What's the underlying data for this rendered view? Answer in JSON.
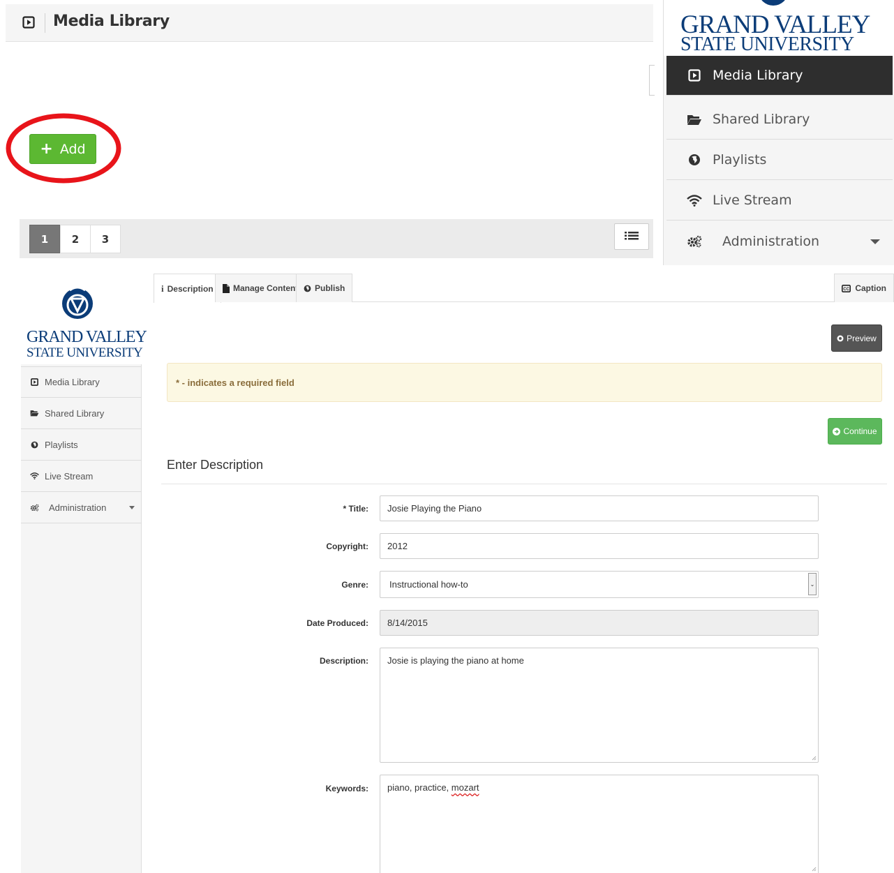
{
  "top_panel": {
    "header_title": "Media Library",
    "add_label": "Add",
    "pages": [
      "1",
      "2",
      "3"
    ],
    "active_page": "1"
  },
  "top_nav": {
    "logo_line1": "GRAND VALLEY",
    "logo_line2": "STATE UNIVERSITY",
    "items": [
      {
        "label": "Media Library",
        "icon": "play-square-icon",
        "active": true
      },
      {
        "label": "Shared Library",
        "icon": "folder-open-icon"
      },
      {
        "label": "Playlists",
        "icon": "globe-icon"
      },
      {
        "label": "Live Stream",
        "icon": "wifi-icon"
      },
      {
        "label": "Administration",
        "icon": "cogs-icon",
        "has_dropdown": true
      }
    ]
  },
  "side_nav": {
    "logo_line1": "GRAND VALLEY",
    "logo_line2": "STATE UNIVERSITY",
    "items": [
      {
        "label": "Media Library",
        "icon": "play-square-icon"
      },
      {
        "label": "Shared Library",
        "icon": "folder-open-icon"
      },
      {
        "label": "Playlists",
        "icon": "globe-icon"
      },
      {
        "label": "Live Stream",
        "icon": "wifi-icon"
      },
      {
        "label": "Administration",
        "icon": "cogs-icon",
        "has_dropdown": true
      }
    ]
  },
  "tabs": {
    "description": "Description",
    "manage_content": "Manage Content",
    "publish": "Publish",
    "caption": "Caption"
  },
  "actions": {
    "preview": "Preview",
    "continue": "Continue"
  },
  "alert": "* - indicates a required field",
  "section_title": "Enter Description",
  "form": {
    "title_label": "* Title:",
    "title_value": "Josie Playing the Piano",
    "copyright_label": "Copyright:",
    "copyright_value": "2012",
    "genre_label": "Genre:",
    "genre_value": "Instructional how-to",
    "date_label": "Date Produced:",
    "date_value": "8/14/2015",
    "description_label": "Description:",
    "description_value": "Josie is playing the piano at home",
    "keywords_label": "Keywords:",
    "keywords_value_plain": "piano, practice, ",
    "keywords_value_misspelled": "mozart"
  },
  "colors": {
    "gvsu_blue": "#0b3c78",
    "add_green": "#5cb832",
    "highlight_red": "#e8141a",
    "nav_active": "#2e2e2e",
    "alert_bg": "#fcf8e3",
    "alert_text": "#8a6d3b"
  }
}
